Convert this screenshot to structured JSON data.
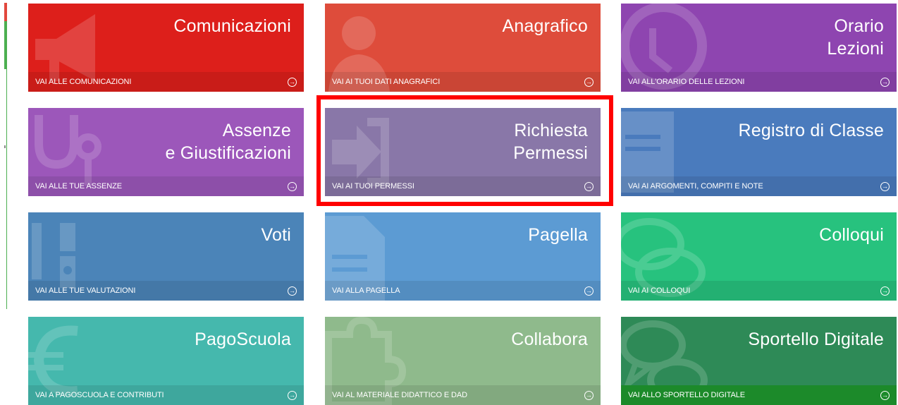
{
  "tiles": [
    {
      "title": "Comunicazioni",
      "link": "VAI ALLE COMUNICAZIONI",
      "icon": "megaphone-icon",
      "color": "#dd1f1b"
    },
    {
      "title": "Anagrafico",
      "link": "VAI AI TUOI DATI ANAGRAFICI",
      "icon": "person-icon",
      "color": "#de4c3b"
    },
    {
      "title": "Orario\nLezioni",
      "link": "VAI ALL'ORARIO DELLE LEZIONI",
      "icon": "clock-icon",
      "color": "#8e45b0"
    },
    {
      "title": "Assenze\ne Giustificazioni",
      "link": "VAI ALLE TUE ASSENZE",
      "icon": "stethoscope-icon",
      "color": "#9c57ba"
    },
    {
      "title": "Richiesta\nPermessi",
      "link": "VAI AI TUOI PERMESSI",
      "icon": "sign-in-icon",
      "color": "#8977a8"
    },
    {
      "title": "Registro di Classe",
      "link": "VAI AI ARGOMENTI, COMPITI E NOTE",
      "icon": "register-icon",
      "color": "#4a7bbd"
    },
    {
      "title": "Voti",
      "link": "VAI ALLE TUE VALUTAZIONI",
      "icon": "grades-icon",
      "color": "#4b84b8"
    },
    {
      "title": "Pagella",
      "link": "VAI ALLA PAGELLA",
      "icon": "document-icon",
      "color": "#5c9bd3"
    },
    {
      "title": "Colloqui",
      "link": "VAI AI COLLOQUI",
      "icon": "chat-icon",
      "color": "#27c27e"
    },
    {
      "title": "PagoScuola",
      "link": "VAI A PAGOSCUOLA E CONTRIBUTI",
      "icon": "euro-icon",
      "color": "#45b8ad"
    },
    {
      "title": "Collabora",
      "link": "VAI AL MATERIALE DIDATTICO E DAD",
      "icon": "puzzle-icon",
      "color": "#8fba8c"
    },
    {
      "title": "Sportello Digitale",
      "link": "VAI ALLO SPORTELLO DIGITALE",
      "icon": "chat-bubbles-icon",
      "color": "#2e8a57",
      "footer_color": "#1c8a2a"
    }
  ],
  "highlight_color": "#ff0000"
}
